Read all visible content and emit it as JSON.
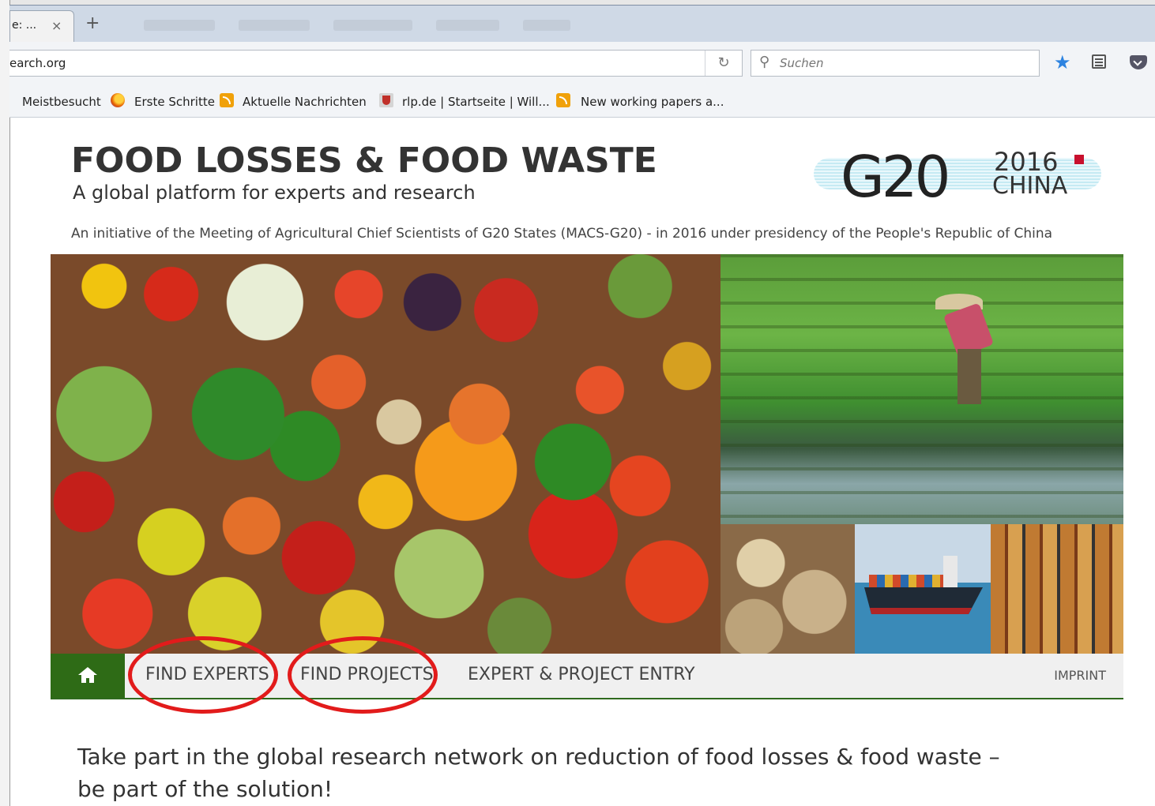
{
  "browser": {
    "tab": {
      "title": "e: ...",
      "close": "×"
    },
    "new_tab": "+",
    "url": "earch.org",
    "reload_glyph": "↻",
    "search_placeholder": "Suchen",
    "bookmarks": [
      {
        "label": "Meistbesucht",
        "icon": "folder-icon"
      },
      {
        "label": "Erste Schritte",
        "icon": "firefox-icon"
      },
      {
        "label": "Aktuelle Nachrichten",
        "icon": "rss-icon"
      },
      {
        "label": "rlp.de | Startseite | Will...",
        "icon": "crest-icon"
      },
      {
        "label": "New working papers a...",
        "icon": "rss-icon"
      }
    ],
    "accent_color": "#2d83e0"
  },
  "header": {
    "title": "FOOD LOSSES & FOOD WASTE",
    "subtitle": "A global platform for experts and research",
    "initiative": "An initiative of the Meeting of Agricultural Chief Scientists of G20 States (MACS-G20) - in 2016 under presidency of the People's Republic of China",
    "logo": {
      "main": "G20",
      "year": "2016",
      "country": "CHINA"
    }
  },
  "nav": {
    "home_icon": "home-icon",
    "items": [
      "FIND EXPERTS",
      "FIND PROJECTS",
      "EXPERT & PROJECT ENTRY"
    ],
    "imprint": "IMPRINT",
    "color": "#2e6b16"
  },
  "highlight_color": "#e21b1b",
  "intro": {
    "line1": "Take part in the global research network on reduction of food losses & food waste –",
    "line2": "be part of the solution!"
  }
}
